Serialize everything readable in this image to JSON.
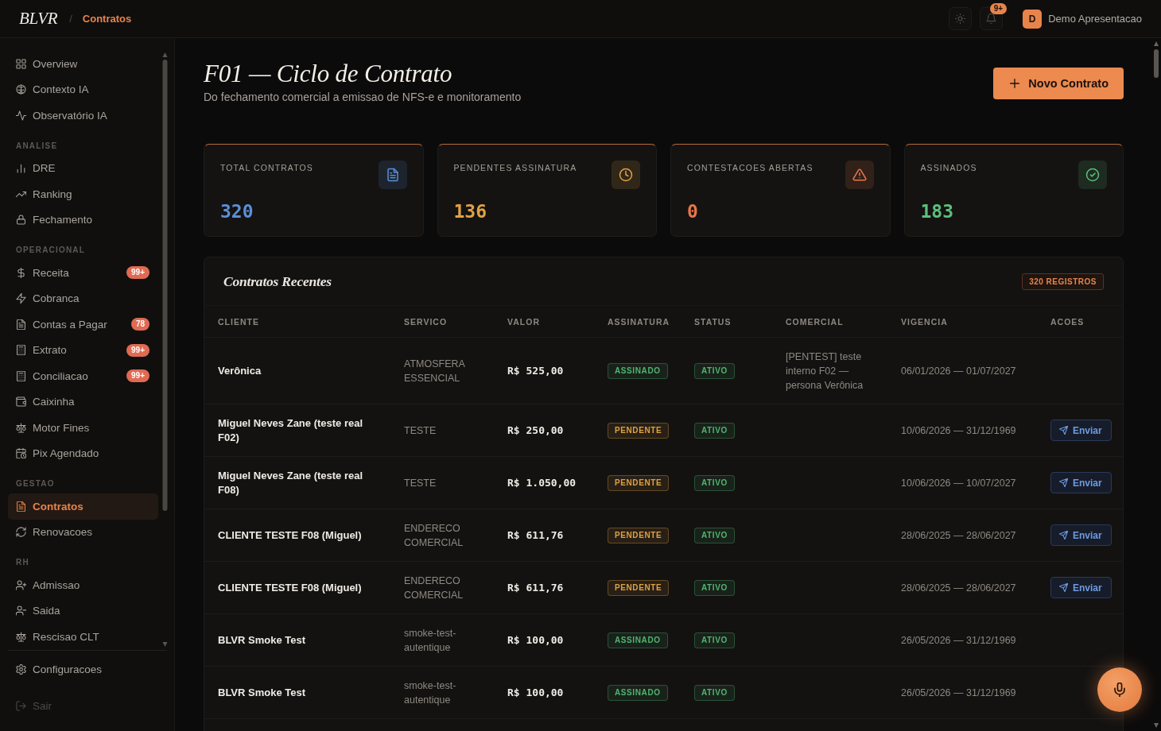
{
  "topbar": {
    "logo": "BLVR",
    "separator": "/",
    "breadcrumb": "Contratos",
    "notifications_badge": "9+",
    "user": {
      "initial": "D",
      "name": "Demo Apresentacao"
    }
  },
  "sidebar": {
    "groups": [
      {
        "items": [
          {
            "label": "Overview",
            "selected": false
          },
          {
            "label": "Contexto IA",
            "selected": false
          },
          {
            "label": "Observatório IA",
            "selected": false
          }
        ]
      },
      {
        "heading": "ANALISE",
        "items": [
          {
            "label": "DRE",
            "selected": false
          },
          {
            "label": "Ranking",
            "selected": false
          },
          {
            "label": "Fechamento",
            "selected": false
          }
        ]
      },
      {
        "heading": "OPERACIONAL",
        "items": [
          {
            "label": "Receita",
            "selected": false,
            "badge": "99+"
          },
          {
            "label": "Cobranca",
            "selected": false
          },
          {
            "label": "Contas a Pagar",
            "selected": false,
            "badge": "78"
          },
          {
            "label": "Extrato",
            "selected": false,
            "badge": "99+"
          },
          {
            "label": "Conciliacao",
            "selected": false,
            "badge": "99+"
          },
          {
            "label": "Caixinha",
            "selected": false
          },
          {
            "label": "Motor Fines",
            "selected": false
          },
          {
            "label": "Pix Agendado",
            "selected": false
          }
        ]
      },
      {
        "heading": "GESTAO",
        "items": [
          {
            "label": "Contratos",
            "selected": true
          },
          {
            "label": "Renovacoes",
            "selected": false
          }
        ]
      },
      {
        "heading": "RH",
        "items": [
          {
            "label": "Admissao",
            "selected": false
          },
          {
            "label": "Saida",
            "selected": false
          },
          {
            "label": "Rescisao CLT",
            "selected": false
          }
        ]
      }
    ],
    "footer": [
      {
        "label": "Configuracoes",
        "selected": false,
        "disabled": false
      },
      {
        "label": "Sair",
        "selected": false,
        "disabled": true
      }
    ]
  },
  "header": {
    "title": "F01 — Ciclo de Contrato",
    "subtitle": "Do fechamento comercial a emissao de NFS-e e monitoramento",
    "primary_button": "Novo Contrato"
  },
  "stats": [
    {
      "label": "TOTAL CONTRATOS",
      "value": "320",
      "color": "#5b8fd8"
    },
    {
      "label": "PENDENTES ASSINATURA",
      "value": "136",
      "color": "#e0a245"
    },
    {
      "label": "CONTESTACOES ABERTAS",
      "value": "0",
      "color": "#e8764a"
    },
    {
      "label": "ASSINADOS",
      "value": "183",
      "color": "#5cbf7a"
    }
  ],
  "contracts": {
    "title": "Contratos Recentes",
    "count_badge": "320 REGISTROS",
    "columns": [
      "CLIENTE",
      "SERVICO",
      "VALOR",
      "ASSINATURA",
      "STATUS",
      "COMERCIAL",
      "VIGENCIA",
      "ACOES"
    ],
    "rows": [
      {
        "client": "Verônica",
        "service": "ATMOSFERA ESSENCIAL",
        "value": "R$ 525,00",
        "signature": {
          "label": "ASSINADO",
          "color": "#4fb56f"
        },
        "status": {
          "label": "ATIVO",
          "color": "#4fb56f"
        },
        "commercial": "[PENTEST] teste interno F02 — persona Verônica",
        "period": "06/01/2026 — 01/07/2027"
      },
      {
        "client": "Miguel Neves Zane (teste real F02)",
        "service": "TESTE",
        "value": "R$ 250,00",
        "signature": {
          "label": "PENDENTE",
          "color": "#e0a040"
        },
        "status": {
          "label": "ATIVO",
          "color": "#4fb56f"
        },
        "period": "10/06/2026 — 31/12/1969",
        "action": "Enviar"
      },
      {
        "client": "Miguel Neves Zane (teste real F08)",
        "service": "TESTE",
        "value": "R$ 1.050,00",
        "signature": {
          "label": "PENDENTE",
          "color": "#e0a040"
        },
        "status": {
          "label": "ATIVO",
          "color": "#4fb56f"
        },
        "period": "10/06/2026 — 10/07/2027",
        "action": "Enviar"
      },
      {
        "client": "CLIENTE TESTE F08 (Miguel)",
        "service": "ENDERECO COMERCIAL",
        "value": "R$ 611,76",
        "signature": {
          "label": "PENDENTE",
          "color": "#e0a040"
        },
        "status": {
          "label": "ATIVO",
          "color": "#4fb56f"
        },
        "period": "28/06/2025 — 28/06/2027",
        "action": "Enviar"
      },
      {
        "client": "CLIENTE TESTE F08 (Miguel)",
        "service": "ENDERECO COMERCIAL",
        "value": "R$ 611,76",
        "signature": {
          "label": "PENDENTE",
          "color": "#e0a040"
        },
        "status": {
          "label": "ATIVO",
          "color": "#4fb56f"
        },
        "period": "28/06/2025 — 28/06/2027",
        "action": "Enviar"
      },
      {
        "client": "BLVR Smoke Test",
        "service": "smoke-test-autentique",
        "value": "R$ 100,00",
        "signature": {
          "label": "ASSINADO",
          "color": "#4fb56f"
        },
        "status": {
          "label": "ATIVO",
          "color": "#4fb56f"
        },
        "period": "26/05/2026 — 31/12/1969"
      },
      {
        "client": "BLVR Smoke Test",
        "service": "smoke-test-autentique",
        "value": "R$ 100,00",
        "signature": {
          "label": "ASSINADO",
          "color": "#4fb56f"
        },
        "status": {
          "label": "ATIVO",
          "color": "#4fb56f"
        },
        "period": "26/05/2026 — 31/12/1969"
      }
    ]
  }
}
